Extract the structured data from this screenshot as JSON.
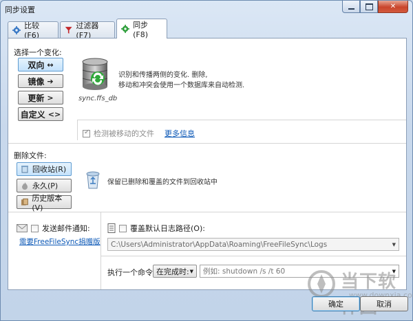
{
  "window": {
    "title": "同步设置"
  },
  "tabs": [
    {
      "label": "比较 (F6)",
      "icon": "gear-icon",
      "active": false
    },
    {
      "label": "过滤器 (F7)",
      "icon": "filter-icon",
      "active": false
    },
    {
      "label": "同步 (F8)",
      "icon": "gear-icon",
      "active": true
    }
  ],
  "variant": {
    "heading": "选择一个变化:",
    "buttons": [
      {
        "label": "双向",
        "arrow": "↔",
        "selected": true
      },
      {
        "label": "镜像",
        "arrow": "➔",
        "selected": false
      },
      {
        "label": "更新",
        "arrow": ">",
        "selected": false
      },
      {
        "label": "自定义",
        "arrow": "<>",
        "selected": false
      }
    ],
    "db_caption": "sync.ffs_db",
    "desc_line1": "识别和传播两侧的变化. 删除,",
    "desc_line2": "移动和冲突会使用一个数据库来自动检测.",
    "detect_moved_label": "检测被移动的文件",
    "detect_moved_checked": true,
    "more_info_link": "更多信息"
  },
  "deletion": {
    "heading": "删除文件:",
    "buttons": [
      {
        "label": "回收站(R)",
        "icon": "recycle-bin-icon",
        "selected": true
      },
      {
        "label": "永久(P)",
        "icon": "fire-icon",
        "selected": false
      },
      {
        "label": "历史版本(V)",
        "icon": "versioning-icon",
        "selected": false
      }
    ],
    "desc": "保留已删除和覆盖的文件到回收站中"
  },
  "email": {
    "label": "发送邮件通知:",
    "checked": false,
    "donate_link": "需要FreeFileSync捐赠版"
  },
  "log": {
    "label": "覆盖默认日志路径(O):",
    "checked": false,
    "path": "C:\\Users\\Administrator\\AppData\\Roaming\\FreeFileSync\\Logs"
  },
  "command": {
    "label": "执行一个命令:",
    "trigger": "在完成时:",
    "placeholder": "例如: shutdown /s /t 60"
  },
  "dialog": {
    "ok": "确定",
    "cancel": "取消"
  },
  "watermark": {
    "main": "当下软件园",
    "sub": "www.downxia.com"
  }
}
